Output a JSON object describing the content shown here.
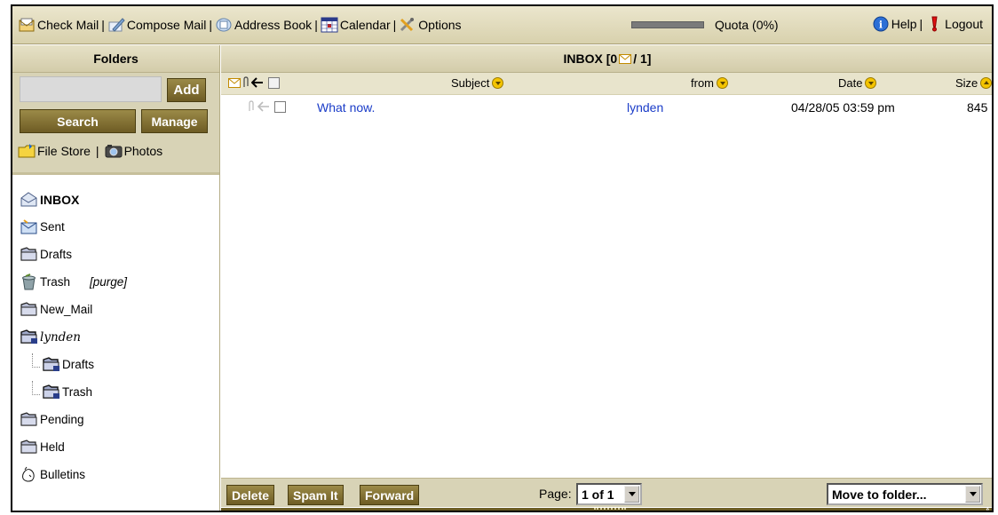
{
  "toolbar": {
    "check_mail": "Check Mail",
    "compose_mail": "Compose Mail",
    "address_book": "Address Book",
    "calendar": "Calendar",
    "options": "Options",
    "separator": "|",
    "quota_label": "Quota (0%)",
    "quota_fraction": 0.0,
    "help": "Help",
    "logout": "Logout"
  },
  "sidebar": {
    "title": "Folders",
    "add_label": "Add",
    "search_label": "Search",
    "manage_label": "Manage",
    "file_store": "File Store",
    "photos": "Photos",
    "folders": [
      {
        "label": "INBOX"
      },
      {
        "label": "Sent"
      },
      {
        "label": "Drafts"
      },
      {
        "label": "Trash",
        "extra": "[purge]"
      },
      {
        "label": "New_Mail"
      },
      {
        "label": "lynden"
      },
      {
        "label": "Drafts"
      },
      {
        "label": "Trash"
      },
      {
        "label": "Pending"
      },
      {
        "label": "Held"
      },
      {
        "label": "Bulletins"
      }
    ]
  },
  "main": {
    "title_prefix": "INBOX [0",
    "title_suffix": "/ 1]",
    "columns": {
      "subject": "Subject",
      "from": "from",
      "date": "Date",
      "size": "Size"
    },
    "messages": [
      {
        "subject": "What now.",
        "from": "lynden",
        "date": "04/28/05 03:59 pm",
        "size": "845"
      }
    ],
    "buttons": {
      "delete": "Delete",
      "spam": "Spam It",
      "forward": "Forward"
    },
    "page_label": "Page:",
    "page_value": "1 of 1",
    "move_to_folder": "Move to folder..."
  },
  "colors": {
    "toolbar_bg": "#ddd7b8",
    "button_olive": "#7e6c2f",
    "link_blue": "#1a3cc8"
  }
}
